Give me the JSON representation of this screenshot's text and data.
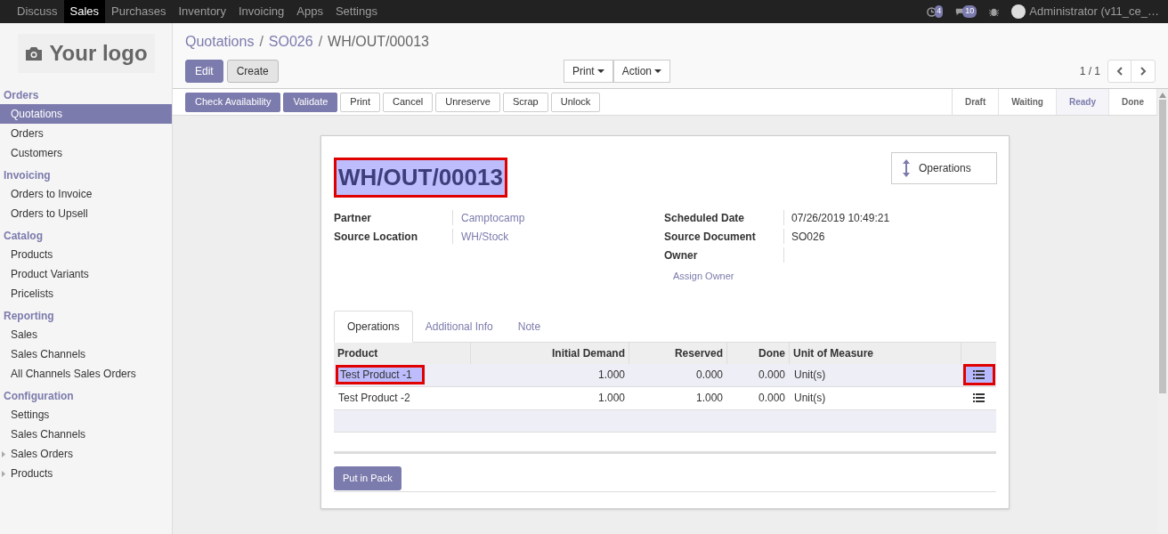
{
  "top_menu": [
    {
      "label": "Discuss",
      "selected": false
    },
    {
      "label": "Sales",
      "selected": true
    },
    {
      "label": "Purchases",
      "selected": false
    },
    {
      "label": "Inventory",
      "selected": false
    },
    {
      "label": "Invoicing",
      "selected": false
    },
    {
      "label": "Apps",
      "selected": false
    },
    {
      "label": "Settings",
      "selected": false
    }
  ],
  "systray": {
    "activity_count": "4",
    "message_count": "10",
    "user": "Administrator (v11_ce_…"
  },
  "logo": "Your logo",
  "sidebar": [
    {
      "title": "Orders",
      "items": [
        {
          "label": "Quotations",
          "selected": true,
          "kind": "link"
        },
        {
          "label": "Orders",
          "selected": false,
          "kind": "link"
        },
        {
          "label": "Customers",
          "selected": false,
          "kind": "link"
        }
      ]
    },
    {
      "title": "Invoicing",
      "items": [
        {
          "label": "Orders to Invoice",
          "selected": false,
          "kind": "link"
        },
        {
          "label": "Orders to Upsell",
          "selected": false,
          "kind": "link"
        }
      ]
    },
    {
      "title": "Catalog",
      "items": [
        {
          "label": "Products",
          "selected": false,
          "kind": "link"
        },
        {
          "label": "Product Variants",
          "selected": false,
          "kind": "link"
        },
        {
          "label": "Pricelists",
          "selected": false,
          "kind": "link"
        }
      ]
    },
    {
      "title": "Reporting",
      "items": [
        {
          "label": "Sales",
          "selected": false,
          "kind": "link"
        },
        {
          "label": "Sales Channels",
          "selected": false,
          "kind": "link"
        },
        {
          "label": "All Channels Sales Orders",
          "selected": false,
          "kind": "link"
        }
      ]
    },
    {
      "title": "Configuration",
      "items": [
        {
          "label": "Settings",
          "selected": false,
          "kind": "link"
        },
        {
          "label": "Sales Channels",
          "selected": false,
          "kind": "link"
        },
        {
          "label": "Sales Orders",
          "selected": false,
          "kind": "folder"
        },
        {
          "label": "Products",
          "selected": false,
          "kind": "folder"
        }
      ]
    }
  ],
  "breadcrumb": [
    {
      "label": "Quotations",
      "kind": "link",
      "separator": "/"
    },
    {
      "label": "SO026",
      "kind": "link",
      "separator": "/"
    },
    {
      "label": "WH/OUT/00013",
      "kind": "current"
    }
  ],
  "control_buttons": [
    {
      "label": "Edit",
      "kind": "primary"
    },
    {
      "label": "Create",
      "kind": "secondary"
    }
  ],
  "dropdowns": [
    "Print",
    "Action"
  ],
  "pager": "1 / 1",
  "action_buttons": [
    {
      "label": "Check Availability",
      "kind": "primary"
    },
    {
      "label": "Validate",
      "kind": "primary"
    },
    {
      "label": "Print",
      "kind": "default"
    },
    {
      "label": "Cancel",
      "kind": "default"
    },
    {
      "label": "Unreserve",
      "kind": "default"
    },
    {
      "label": "Scrap",
      "kind": "default"
    },
    {
      "label": "Unlock",
      "kind": "default"
    }
  ],
  "stages": [
    {
      "label": "Draft",
      "selected": false
    },
    {
      "label": "Waiting",
      "selected": false
    },
    {
      "label": "Ready",
      "selected": true
    },
    {
      "label": "Done",
      "selected": false
    }
  ],
  "form": {
    "title": "WH/OUT/00013",
    "title_highlighted": true,
    "smart_button": "Operations",
    "left_fields": [
      {
        "label": "Partner",
        "value": "Camptocamp",
        "kind": "link"
      },
      {
        "label": "Source Location",
        "value": "WH/Stock",
        "kind": "link"
      }
    ],
    "right_fields": [
      {
        "label": "Scheduled Date",
        "value": "07/26/2019 10:49:21"
      },
      {
        "label": "Source Document",
        "value": "SO026"
      },
      {
        "label": "Owner"
      }
    ],
    "assign_owner": "Assign Owner",
    "tabs": [
      {
        "label": "Operations",
        "selected": true
      },
      {
        "label": "Additional Info",
        "selected": false
      },
      {
        "label": "Note",
        "selected": false
      }
    ],
    "table": {
      "columns": [
        "Product",
        "Initial Demand",
        "Reserved",
        "Done",
        "Unit of Measure"
      ],
      "rows": [
        {
          "product": "Test Product -1",
          "initial_demand": "1.000",
          "reserved": "0.000",
          "done": "0.000",
          "uom": "Unit(s)",
          "selected": true,
          "highlighted": true
        },
        {
          "product": "Test Product -2",
          "initial_demand": "1.000",
          "reserved": "1.000",
          "done": "0.000",
          "uom": "Unit(s)",
          "selected": false,
          "highlighted": false
        }
      ]
    },
    "pack_button": "Put in Pack"
  }
}
